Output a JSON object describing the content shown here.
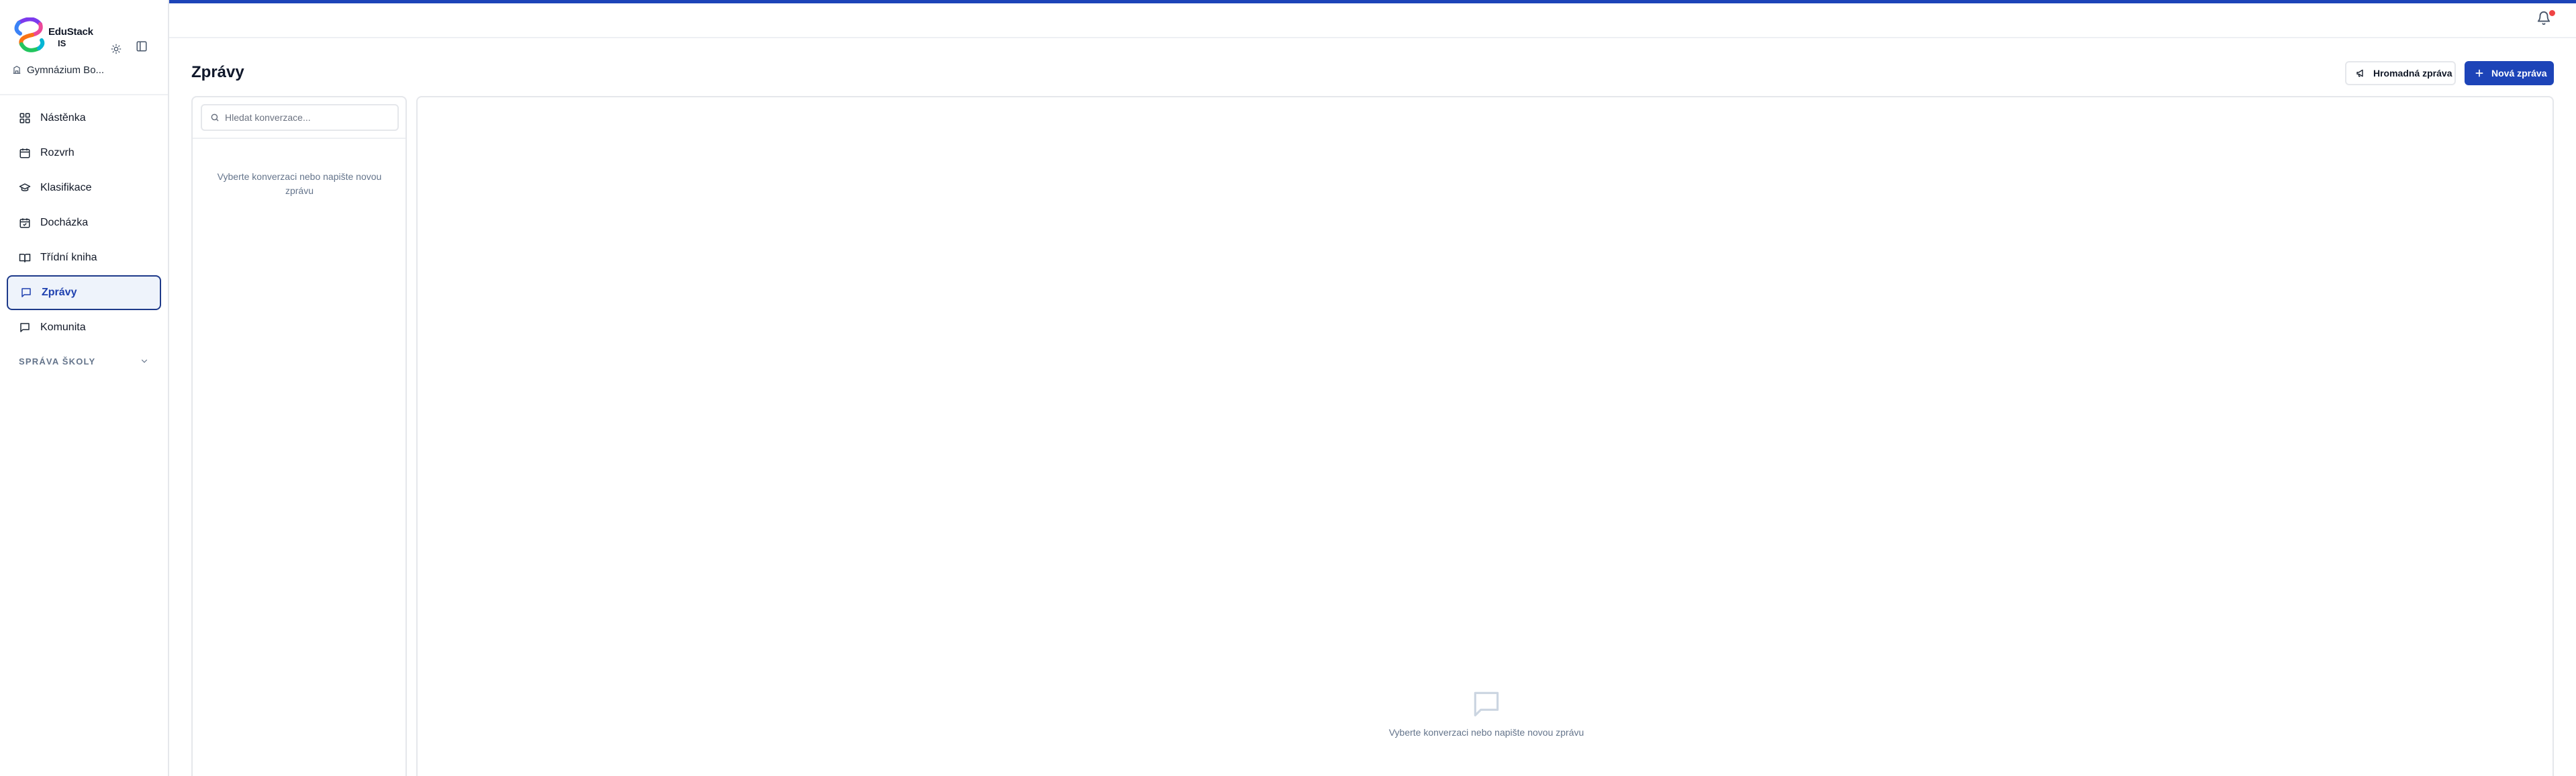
{
  "brand": {
    "name": "EduStack",
    "sub": "IS",
    "school": "Gymnázium Bo..."
  },
  "nav": {
    "items": [
      {
        "label": "Nástěnka",
        "icon": "dashboard-grid-icon"
      },
      {
        "label": "Rozvrh",
        "icon": "calendar-icon"
      },
      {
        "label": "Klasifikace",
        "icon": "graduation-cap-icon"
      },
      {
        "label": "Docházka",
        "icon": "calendar-check-icon"
      },
      {
        "label": "Třídní kniha",
        "icon": "open-book-icon"
      },
      {
        "label": "Zprávy",
        "icon": "message-square-icon",
        "active": true
      },
      {
        "label": "Komunita",
        "icon": "message-square-icon"
      }
    ],
    "section_label": "SPRÁVA ŠKOLY"
  },
  "topbar": {
    "notification_count": ""
  },
  "header": {
    "title": "Zprávy",
    "broadcast_label": "Hromadná zpráva",
    "new_message_label": "Nová zpráva"
  },
  "list": {
    "search_placeholder": "Hledat konverzace...",
    "empty_text": "Vyberte konverzaci nebo napište novou zprávu"
  },
  "chat": {
    "empty_text": "Vyberte konverzaci nebo napište novou zprávu"
  },
  "colors": {
    "accent": "#1d44b8",
    "active_border": "#1e3a8a",
    "badge": "#ef4444",
    "muted_text": "#64748b"
  }
}
